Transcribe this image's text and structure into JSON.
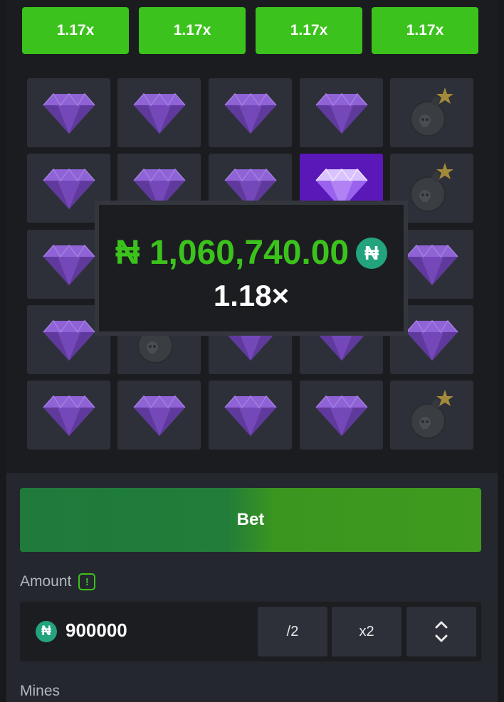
{
  "multipliers": [
    "1.17x",
    "1.17x",
    "1.17x",
    "1.17x"
  ],
  "grid": [
    [
      "gem",
      "gem",
      "gem",
      "gem",
      "mine"
    ],
    [
      "gem",
      "gem",
      "gem",
      "gem-active",
      "mine"
    ],
    [
      "gem",
      "hidden",
      "hidden",
      "hidden",
      "gem"
    ],
    [
      "gem",
      "mine",
      "gem",
      "gem",
      "gem"
    ],
    [
      "gem",
      "gem",
      "gem",
      "gem",
      "mine"
    ]
  ],
  "win_popup": {
    "amount": "₦ 1,060,740.00",
    "currency_symbol": "₦",
    "multiplier": "1.18×"
  },
  "bet_button_label": "Bet",
  "amount": {
    "label": "Amount",
    "info_symbol": "!",
    "currency_symbol": "₦",
    "value": "900000",
    "half_label": "/2",
    "double_label": "x2"
  },
  "mines": {
    "label": "Mines"
  },
  "colors": {
    "accent_green": "#3cc21c",
    "gem_purple": "#7a4cc0",
    "active_tile": "#5a18b8",
    "coin_teal": "#23a37e"
  }
}
